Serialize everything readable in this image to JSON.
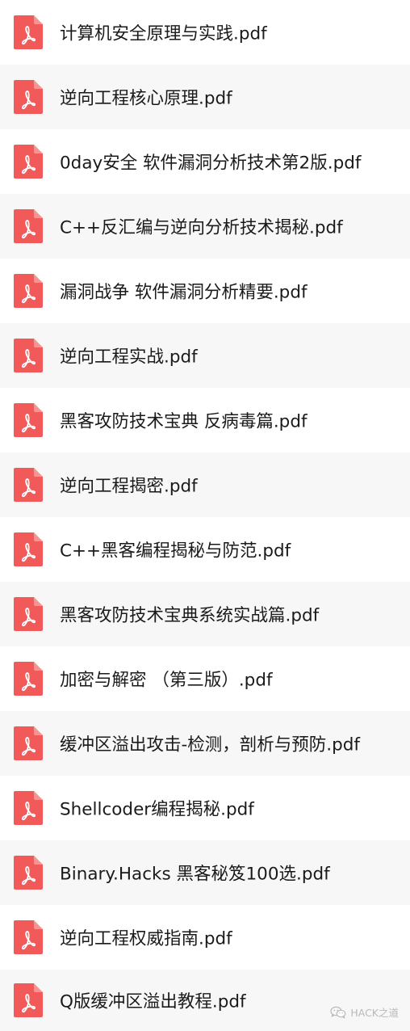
{
  "files": [
    {
      "name": "计算机安全原理与实践.pdf"
    },
    {
      "name": "逆向工程核心原理.pdf"
    },
    {
      "name": "0day安全 软件漏洞分析技术第2版.pdf"
    },
    {
      "name": "C++反汇编与逆向分析技术揭秘.pdf"
    },
    {
      "name": "漏洞战争  软件漏洞分析精要.pdf"
    },
    {
      "name": "逆向工程实战.pdf"
    },
    {
      "name": "黑客攻防技术宝典  反病毒篇.pdf"
    },
    {
      "name": "逆向工程揭密.pdf"
    },
    {
      "name": "C++黑客编程揭秘与防范.pdf"
    },
    {
      "name": "黑客攻防技术宝典系统实战篇.pdf"
    },
    {
      "name": "加密与解密  （第三版）.pdf"
    },
    {
      "name": "缓冲区溢出攻击-检测，剖析与预防.pdf"
    },
    {
      "name": "Shellcoder编程揭秘.pdf"
    },
    {
      "name": "Binary.Hacks 黑客秘笈100选.pdf"
    },
    {
      "name": "逆向工程权威指南.pdf"
    },
    {
      "name": "Q版缓冲区溢出教程.pdf"
    }
  ],
  "icon": "pdf-file-icon",
  "colors": {
    "pdf_icon": "#f25a5a",
    "row_alt": "#f7f7f7",
    "text": "#1a1a1a"
  },
  "watermark": {
    "icon": "wechat-icon",
    "text": "HACK之道"
  }
}
